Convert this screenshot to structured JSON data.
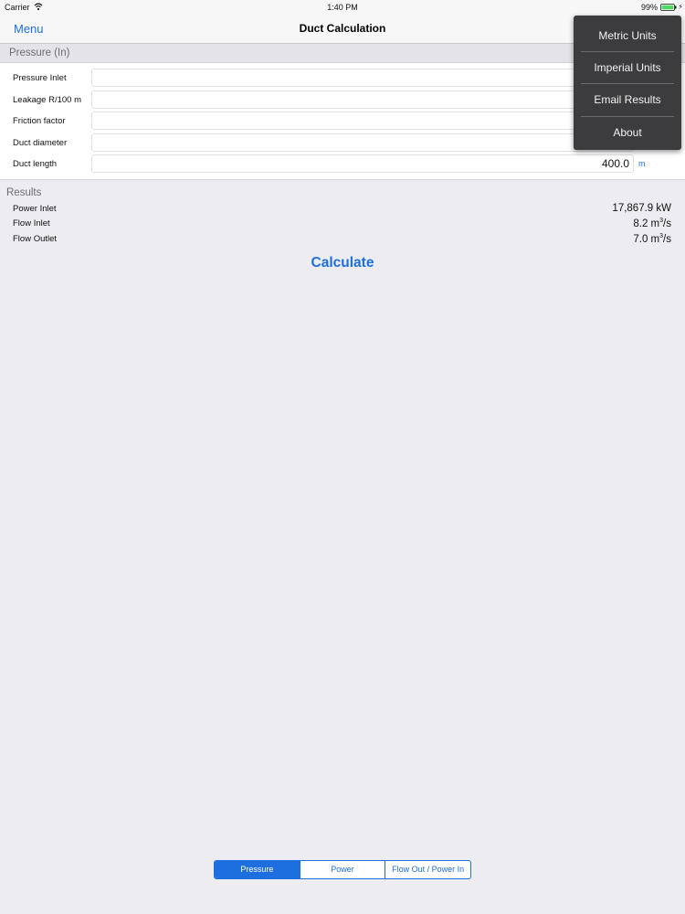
{
  "status_bar": {
    "carrier": "Carrier",
    "time": "1:40 PM",
    "battery_percent": "99%",
    "icons": [
      "wifi-icon",
      "battery-icon",
      "charge-icon"
    ],
    "battery_color": "#4cd964"
  },
  "nav": {
    "menu_label": "Menu",
    "title": "Duct Calculation"
  },
  "section": {
    "title": "Pressure (In)"
  },
  "form": {
    "rows": [
      {
        "label": "Pressure Inlet",
        "value": "",
        "unit": ""
      },
      {
        "label": "Leakage R/100 m",
        "value": "",
        "unit": ""
      },
      {
        "label": "Friction factor",
        "value": "",
        "unit": ""
      },
      {
        "label": "Duct diameter",
        "value": "",
        "unit": ""
      },
      {
        "label": "Duct length",
        "value": "400.0",
        "unit": "m"
      }
    ]
  },
  "results": {
    "title": "Results",
    "rows": [
      {
        "label": "Power Inlet",
        "value": "17,867.9 kW",
        "unit_base": "",
        "unit_sup": ""
      },
      {
        "label": "Flow Inlet",
        "value": "8.2 m",
        "unit_sup": "3",
        "unit_tail": "/s"
      },
      {
        "label": "Flow Outlet",
        "value": "7.0 m",
        "unit_sup": "3",
        "unit_tail": "/s"
      }
    ]
  },
  "calculate_label": "Calculate",
  "segments": {
    "items": [
      "Pressure",
      "Power",
      "Flow Out / Power In"
    ],
    "selected": "Pressure"
  },
  "dropdown": {
    "items": [
      "Metric Units",
      "Imperial Units",
      "Email Results",
      "About"
    ]
  },
  "colors": {
    "accent": "#1d6fe0",
    "background": "#ececf1",
    "menu_background": "#3c3c3e"
  }
}
